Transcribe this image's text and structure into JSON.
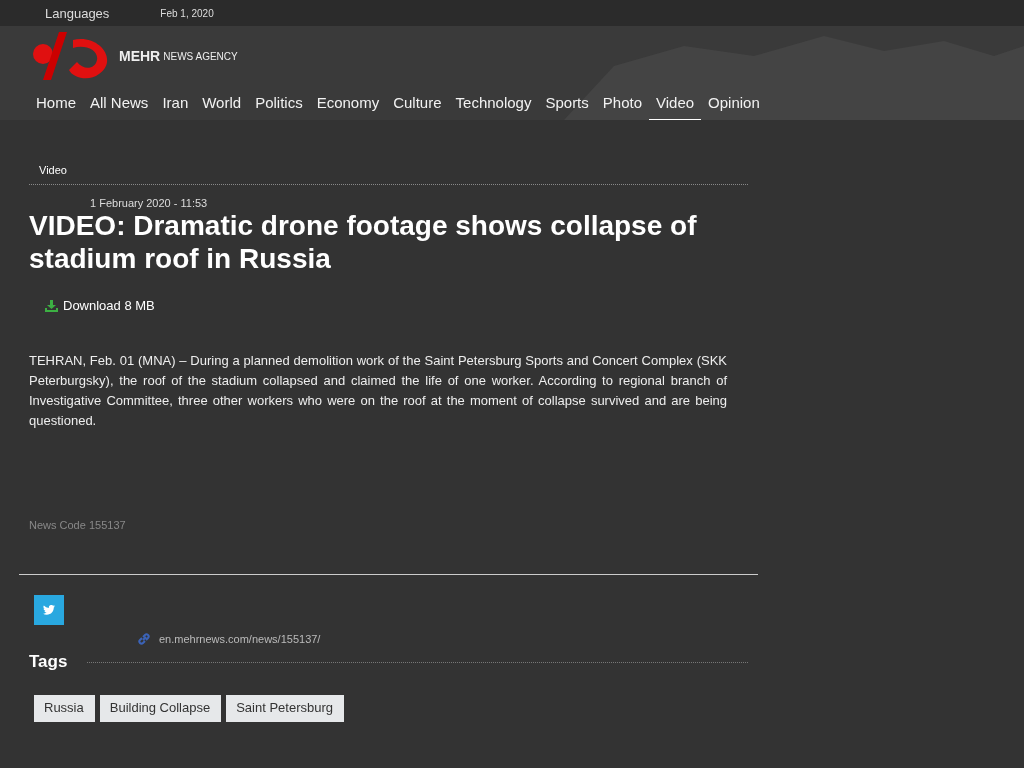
{
  "top_bar": {
    "languages": "Languages",
    "date": "Feb 1, 2020"
  },
  "logo": {
    "brand": "MEHR",
    "tagline": "NEWS AGENCY"
  },
  "nav": [
    {
      "label": "Home",
      "selected": false
    },
    {
      "label": "All News",
      "selected": false
    },
    {
      "label": "Iran",
      "selected": false
    },
    {
      "label": "World",
      "selected": false
    },
    {
      "label": "Politics",
      "selected": false
    },
    {
      "label": "Economy",
      "selected": false
    },
    {
      "label": "Culture",
      "selected": false
    },
    {
      "label": "Technology",
      "selected": false
    },
    {
      "label": "Sports",
      "selected": false
    },
    {
      "label": "Photo",
      "selected": false
    },
    {
      "label": "Video",
      "selected": true
    },
    {
      "label": "Opinion",
      "selected": false
    }
  ],
  "article": {
    "section": "Video",
    "date": "1 February 2020 - 11:53",
    "title": "VIDEO: Dramatic drone footage shows collapse of stadium roof in Russia",
    "download": "Download 8 MB",
    "body": "TEHRAN, Feb. 01 (MNA) – During a planned demolition work of the Saint Petersburg Sports and Concert Complex (SKK Peterburgsky), the roof of the stadium collapsed and claimed the life of one worker. According to regional branch of Investigative Committee, three other workers who were on the roof at the moment of collapse survived and are being questioned.",
    "news_code": "News Code 155137",
    "short_link": "en.mehrnews.com/news/155137/"
  },
  "tags": {
    "heading": "Tags",
    "items": [
      "Russia",
      "Building Collapse",
      "Saint Petersburg"
    ]
  }
}
